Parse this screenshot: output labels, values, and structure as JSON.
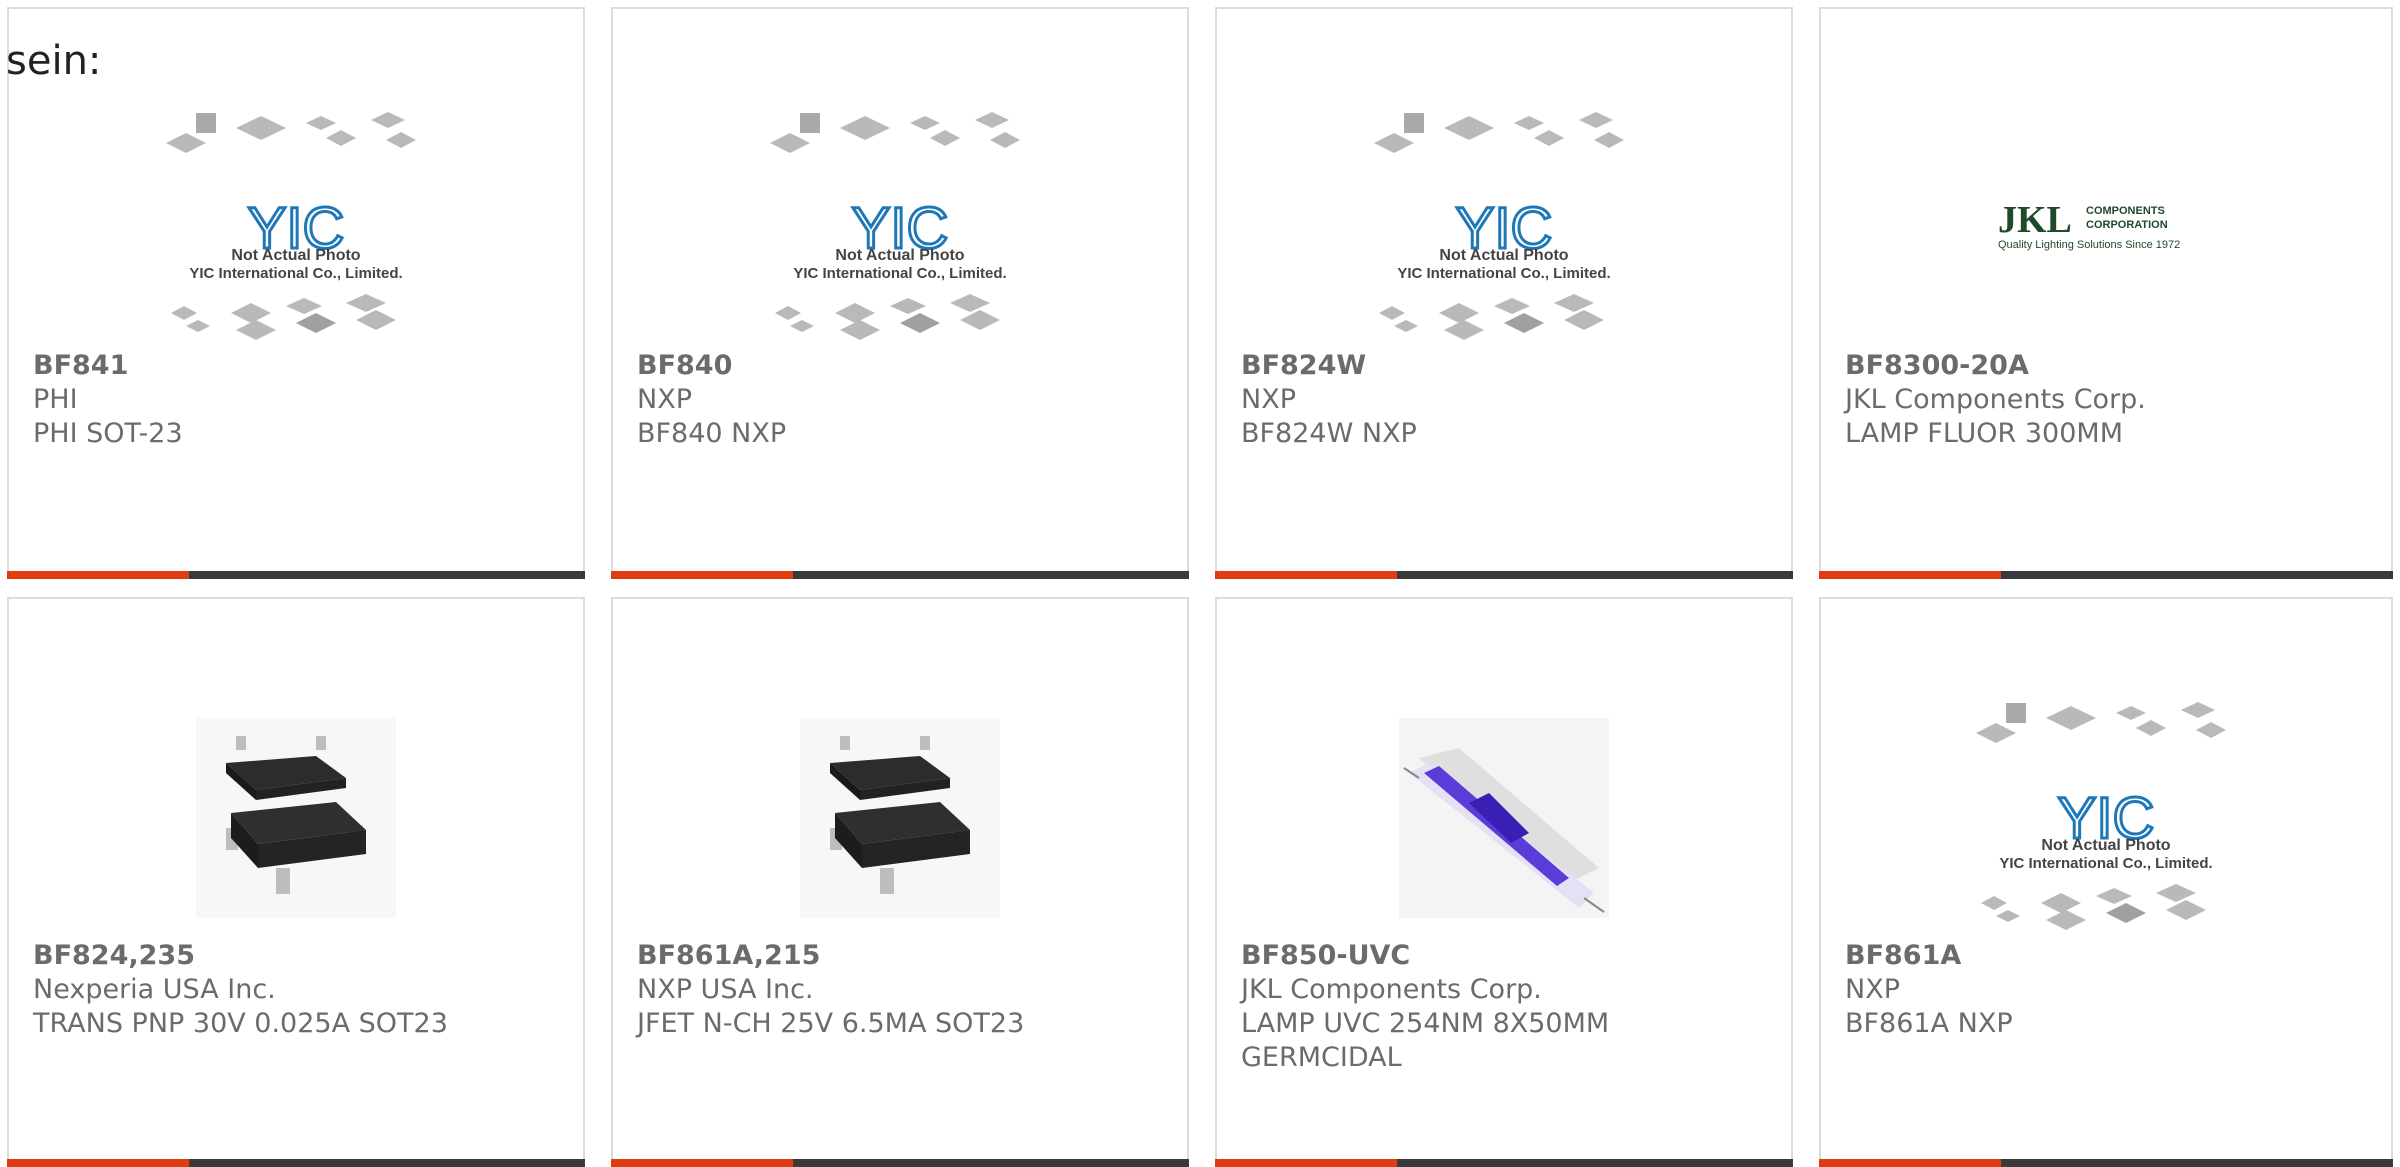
{
  "top_label": "sein:",
  "placeholder_logo": {
    "title": "YIC",
    "line1": "Not Actual Photo",
    "line2": "YIC International Co., Limited."
  },
  "jkl_logo": {
    "main": "JKL",
    "line1": "COMPONENTS",
    "line2": "CORPORATION",
    "tagline": "Quality Lighting Solutions Since 1972"
  },
  "colors": {
    "accent": "#e03c12",
    "bar": "#3a3a3a",
    "border": "#dcdcdc",
    "text": "#6b6b6b"
  },
  "cards": [
    {
      "part": "BF841",
      "manufacturer": "PHI",
      "description": "PHI SOT-23",
      "image": "placeholder"
    },
    {
      "part": "BF840",
      "manufacturer": "NXP",
      "description": "BF840 NXP",
      "image": "placeholder"
    },
    {
      "part": "BF824W",
      "manufacturer": "NXP",
      "description": "BF824W NXP",
      "image": "placeholder"
    },
    {
      "part": "BF8300-20A",
      "manufacturer": "JKL Components Corp.",
      "description": "LAMP FLUOR 300MM",
      "image": "jkl-logo"
    },
    {
      "part": "BF824,235",
      "manufacturer": "Nexperia USA Inc.",
      "description": "TRANS PNP 30V 0.025A SOT23",
      "image": "sot23"
    },
    {
      "part": "BF861A,215",
      "manufacturer": "NXP USA Inc.",
      "description": "JFET N-CH 25V 6.5MA SOT23",
      "image": "sot23"
    },
    {
      "part": "BF850-UVC",
      "manufacturer": "JKL Components Corp.",
      "description": "LAMP UVC 254NM 8X50MM GERMCIDAL",
      "image": "uv-lamp"
    },
    {
      "part": "BF861A",
      "manufacturer": "NXP",
      "description": "BF861A NXP",
      "image": "placeholder"
    }
  ]
}
